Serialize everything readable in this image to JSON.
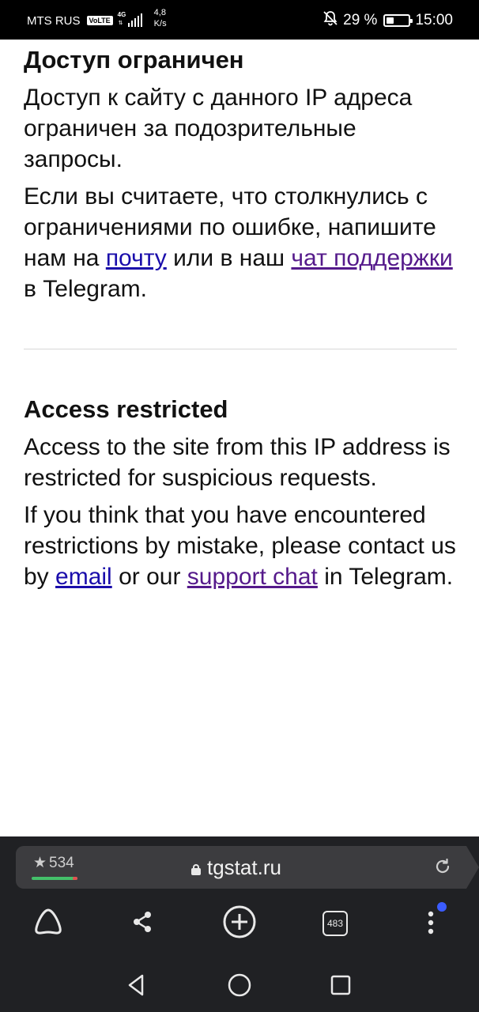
{
  "status_bar": {
    "carrier": "MTS RUS",
    "volte": "VoLTE",
    "network": "4G",
    "speed_value": "4,8",
    "speed_unit": "K/s",
    "battery_percent": "29 %",
    "time": "15:00"
  },
  "content": {
    "ru": {
      "title": "Доступ ограничен",
      "paragraph1": "Доступ к сайту с данного IP адреса ограничен за подозрительные запросы.",
      "p2_text1": "Если вы считаете, что столкнулись с ограничениями по ошибке, напишите нам на ",
      "p2_link1": "почту",
      "p2_text2": " или в наш ",
      "p2_link2": "чат поддержки",
      "p2_text3": " в Telegram."
    },
    "en": {
      "title": "Access restricted",
      "paragraph1": "Access to the site from this IP address is restricted for suspicious requests.",
      "p2_text1": "If you think that you have encountered restrictions by mistake, please contact us by ",
      "p2_link1": "email",
      "p2_text2": " or our ",
      "p2_link2": "support chat",
      "p2_text3": " in Telegram."
    }
  },
  "browser": {
    "rating": "534",
    "url": "tgstat.ru",
    "tabs_count": "483"
  },
  "colors": {
    "link": "#1a0dab",
    "visited_link": "#551a8b",
    "toolbar_bg": "#202124",
    "notification_dot": "#3b5cff"
  }
}
